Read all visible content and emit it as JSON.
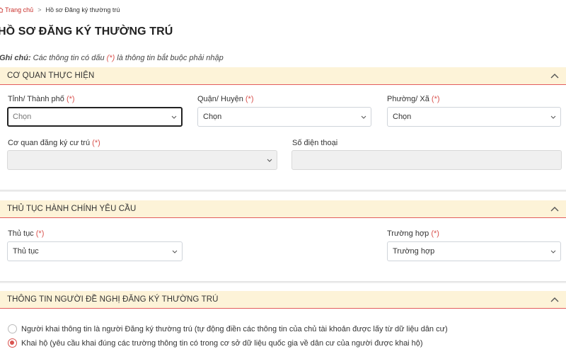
{
  "breadcrumb": {
    "home_label": "Trang chủ",
    "separator": ">",
    "current_label": "Hồ sơ Đăng ký thường trú"
  },
  "page": {
    "title": "HỒ SƠ ĐĂNG KÝ THƯỜNG TRÚ"
  },
  "note": {
    "prefix": "Ghi chú:",
    "text_before": " Các thông tin có dấu ",
    "marker": "(*)",
    "text_after": " là thông tin bắt buộc phải nhập"
  },
  "sections": {
    "agency": {
      "title": "CƠ QUAN THỰC HIỆN",
      "province": {
        "label": "Tỉnh/ Thành phố",
        "required": "(*)",
        "value": "Chọn"
      },
      "district": {
        "label": "Quận/ Huyện",
        "required": "(*)",
        "value": "Chọn"
      },
      "ward": {
        "label": "Phường/ Xã",
        "required": "(*)",
        "value": "Chọn"
      },
      "registry_office": {
        "label": "Cơ quan đăng ký cư trú",
        "required": "(*)",
        "value": ""
      },
      "phone": {
        "label": "Số điện thoại",
        "value": ""
      }
    },
    "procedure": {
      "title": "THỦ TỤC HÀNH CHÍNH YÊU CẦU",
      "procedure_field": {
        "label": "Thủ tục",
        "required": "(*)",
        "value": "Thủ tục"
      },
      "case_field": {
        "label": "Trường hợp",
        "required": "(*)",
        "value": "Trường hợp"
      }
    },
    "applicant": {
      "title": "THÔNG TIN NGƯỜI ĐỀ NGHỊ ĐĂNG KÝ THƯỜNG TRÚ",
      "options": [
        {
          "label": "Người khai thông tin là người Đăng ký thường trú (tự động điền các thông tin của chủ tài khoản được lấy từ dữ liệu dân cư)",
          "checked": false
        },
        {
          "label": "Khai hộ (yêu cầu khai đúng các trường thông tin có trong cơ sở dữ liệu quốc gia về dân cư của người được khai hộ)",
          "checked": true
        }
      ]
    }
  },
  "colors": {
    "accent": "#d9534f",
    "section_bg": "#fdf3d8"
  },
  "icons": {
    "home": "home-icon",
    "collapse": "chevron-up-icon",
    "dropdown": "chevron-down-icon"
  }
}
